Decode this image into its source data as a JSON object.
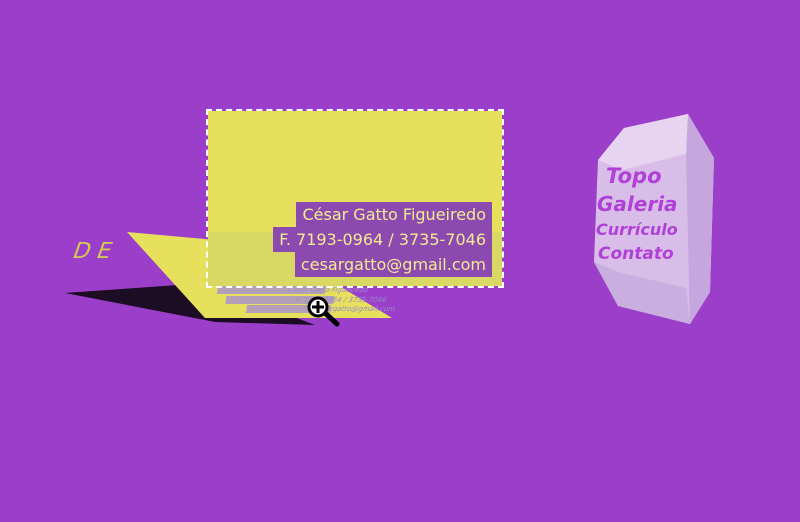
{
  "card": {
    "name": "César Gatto Figueiredo",
    "phone": "F. 7193-0964 / 3735-7046",
    "email": "cesargatto@gmail.com"
  },
  "back_card": {
    "lines": [
      "César Gatto Figueiredo",
      "F. 7193-0964 / 3735-7046",
      "cesargatto@gmail.com"
    ]
  },
  "nav": {
    "items": [
      {
        "label": "Topo"
      },
      {
        "label": "Galeria"
      },
      {
        "label": "Currículo"
      },
      {
        "label": "Contato"
      }
    ]
  },
  "colors": {
    "background": "#9b3fca",
    "card": "#e6e05c",
    "label_bg": "#8c4ab0",
    "label_text": "#f2eb90",
    "crystal": "#d6b6e6",
    "nav_text": "#b040d8"
  },
  "icons": {
    "cursor": "zoom-in-icon"
  }
}
